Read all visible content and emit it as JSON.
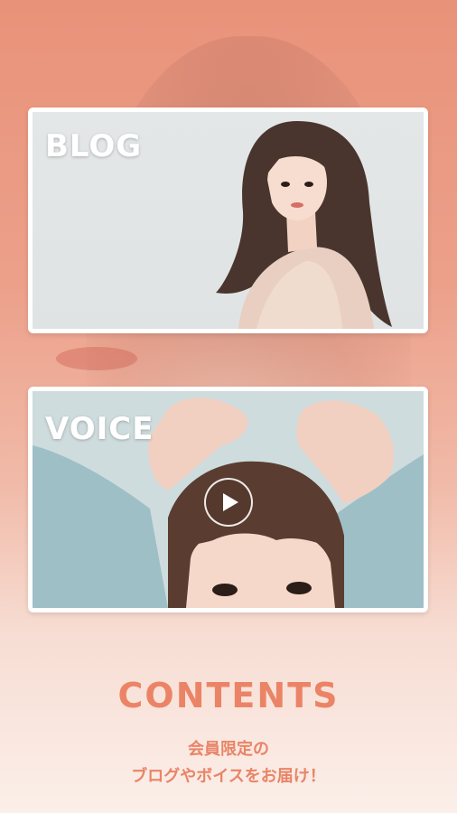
{
  "cards": [
    {
      "title": "BLOG"
    },
    {
      "title": "VOICE"
    }
  ],
  "contents": {
    "heading": "CONTENTS",
    "line1": "会員限定の",
    "line2": "ブログやボイスをお届け！"
  },
  "colors": {
    "accent": "#eb8466",
    "background_top": "#e9927a",
    "background_bottom": "#fbefe9",
    "card_border": "#ffffff"
  },
  "icons": {
    "play": "play-icon"
  }
}
